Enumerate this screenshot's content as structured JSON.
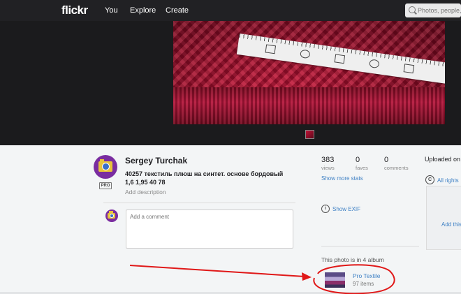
{
  "header": {
    "logo": "flickr",
    "nav": [
      "You",
      "Explore",
      "Create"
    ],
    "search_placeholder": "Photos, people,"
  },
  "owner": {
    "name": "Sergey Turchak",
    "badge": "PRO",
    "title": "40257 текстиль плюш на синтет. основе бордовый 1,6 1,95 40 78",
    "add_description": "Add description"
  },
  "comment": {
    "placeholder": "Add a comment"
  },
  "stats": [
    {
      "value": "383",
      "label": "views"
    },
    {
      "value": "0",
      "label": "faves"
    },
    {
      "value": "0",
      "label": "comments"
    }
  ],
  "show_more_stats": "Show more stats",
  "uploaded": "Uploaded on",
  "license": {
    "icon": "C",
    "text": "All rights"
  },
  "add_this": "Add this",
  "exif": {
    "icon": "i",
    "text": "Show EXIF"
  },
  "albums": {
    "intro": "This photo is in 4 album",
    "name": "Pro Textile",
    "count": "97 items"
  },
  "colors": {
    "accent": "#3c7fc4",
    "topbar": "#212124",
    "annotation": "#e01818"
  }
}
